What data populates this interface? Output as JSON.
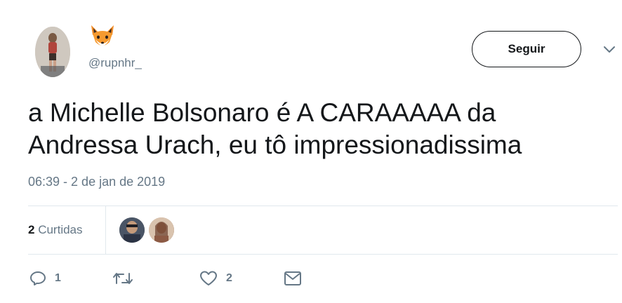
{
  "user": {
    "handle": "@rupnhr_",
    "display_name_icon": "fox-face-emoji"
  },
  "follow_button": {
    "label": "Seguir"
  },
  "tweet": {
    "text_line1": "a Michelle Bolsonaro é A CARAAAAA da",
    "text_line2": "Andressa Urach, eu tô impressionadissima",
    "timestamp": "06:39 - 2 de jan de 2019"
  },
  "likes": {
    "count": "2",
    "label": "Curtidas"
  },
  "actions": {
    "reply_count": "1",
    "like_count": "2"
  },
  "colors": {
    "text_primary": "#14171a",
    "text_secondary": "#657786",
    "divider": "#e1e8ed"
  }
}
